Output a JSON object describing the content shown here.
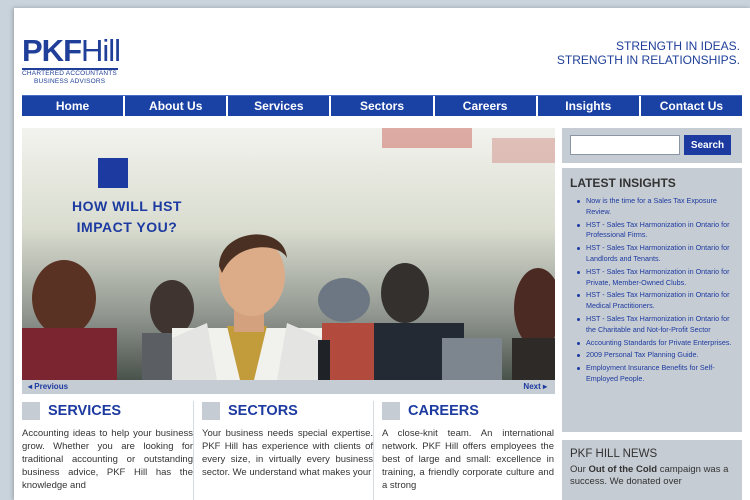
{
  "header": {
    "logo_main": "PKF",
    "logo_main_2": "Hill",
    "logo_sub1": "Chartered Accountants",
    "logo_sub2": "Business Advisors",
    "tagline_1": "STRENGTH IN IDEAS.",
    "tagline_2": "STRENGTH IN RELATIONSHIPS."
  },
  "nav": [
    "Home",
    "About Us",
    "Services",
    "Sectors",
    "Careers",
    "Insights",
    "Contact Us"
  ],
  "hero": {
    "headline_1": "HOW WILL HST",
    "headline_2": "IMPACT YOU?",
    "prev_label": "◂ Previous",
    "next_label": "Next ▸"
  },
  "columns": [
    {
      "title": "SERVICES",
      "body": "Accounting ideas to help your business grow. Whether you are looking for traditional accounting or outstanding business advice, PKF Hill has the knowledge and"
    },
    {
      "title": "SECTORS",
      "body": "Your business needs special expertise. PKF Hill has experience with clients of every size, in virtually every business sector. We understand what makes your"
    },
    {
      "title": "CAREERS",
      "body": "A close-knit team. An international network. PKF Hill offers employees the best of large and small: excellence in training, a friendly corporate culture and a strong"
    }
  ],
  "search": {
    "placeholder": "",
    "button_label": "Search"
  },
  "insights": {
    "title": "LATEST INSIGHTS",
    "items": [
      "Now is the time for a Sales Tax Exposure Review.",
      "HST - Sales Tax Harmonization in Ontario for Professional Firms.",
      "HST - Sales Tax Harmonization in Ontario for Landlords and Tenants.",
      "HST - Sales Tax Harmonization in Ontario for Private, Member-Owned Clubs.",
      "HST - Sales Tax Harmonization in Ontario for Medical Practitioners.",
      "HST - Sales Tax Harmonization in Ontario for the Charitable and Not-for-Profit Sector",
      "Accounting Standards for Private Enterprises.",
      "2009 Personal Tax Planning Guide.",
      "Employment Insurance Benefits for Self-Employed People."
    ]
  },
  "news": {
    "title": "PKF HILL NEWS",
    "body_1": "Our ",
    "body_bold": "Out of the Cold",
    "body_2": " campaign was a success. We donated over"
  },
  "colors": {
    "brand_blue": "#1c3aa0",
    "panel_gray": "#c6ccd3"
  }
}
